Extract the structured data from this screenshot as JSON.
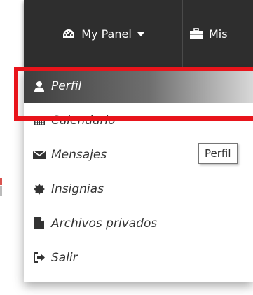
{
  "navbar": {
    "panel_label": "My Panel",
    "mis_label": "Mis"
  },
  "menu": {
    "items": [
      {
        "label": "Perfil",
        "icon": "user-icon"
      },
      {
        "label": "Calendario",
        "icon": "calendar-icon"
      },
      {
        "label": "Mensajes",
        "icon": "envelope-icon"
      },
      {
        "label": "Insignias",
        "icon": "badge-icon"
      },
      {
        "label": "Archivos privados",
        "icon": "file-icon"
      },
      {
        "label": "Salir",
        "icon": "sign-out-icon"
      }
    ]
  },
  "tooltip": {
    "text": "Perfil"
  },
  "colors": {
    "navbar_bg": "#2e2e2e",
    "highlight_border": "#e8141b",
    "menu_text": "#333333"
  }
}
